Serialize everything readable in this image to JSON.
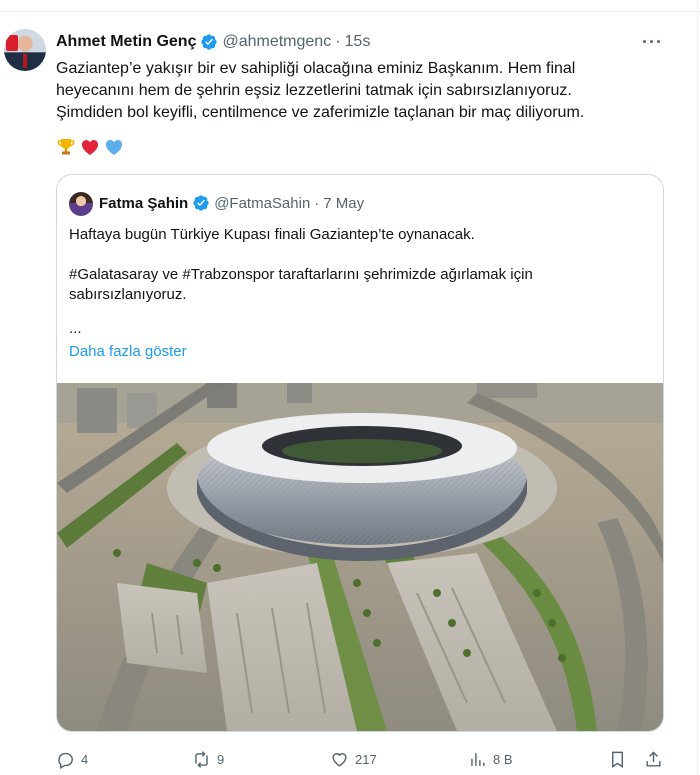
{
  "author": {
    "name": "Ahmet Metin Genç",
    "handle": "@ahmetmgenc",
    "separator": "·",
    "time": "15s"
  },
  "tweet_text": {
    "line1": "Gaziantep’e yakışır bir ev sahipliği olacağına eminiz Başkanım. Hem final",
    "line2": "heyecanını hem de şehrin eşsiz lezzetlerini tatmak için sabırsızlanıyoruz.",
    "line3": "Şimdiden bol keyifli, centilmence ve zaferimizle taçlanan bir maç diliyorum."
  },
  "emojis": [
    "trophy",
    "red-heart",
    "blue-heart"
  ],
  "quoted": {
    "name": "Fatma Şahin",
    "handle": "@FatmaSahin",
    "separator": "·",
    "time": "7 May",
    "paragraph1": "Haftaya bugün Türkiye Kupası finali Gaziantep’te oynanacak.",
    "paragraph2_line1": "#Galatasaray ve #Trabzonspor taraftarlarını şehrimizde ağırlamak için",
    "paragraph2_line2": "sabırsızlanıyoruz.",
    "ellipsis": "...",
    "show_more": "Daha fazla göster"
  },
  "actions": {
    "replies": "4",
    "reposts": "9",
    "likes": "217",
    "views": "8 B"
  },
  "colors": {
    "verified": "#1d9bf0",
    "link": "#1d9bf0",
    "secondary_text": "#536471",
    "border": "#cfd9de"
  },
  "more_menu": "···"
}
